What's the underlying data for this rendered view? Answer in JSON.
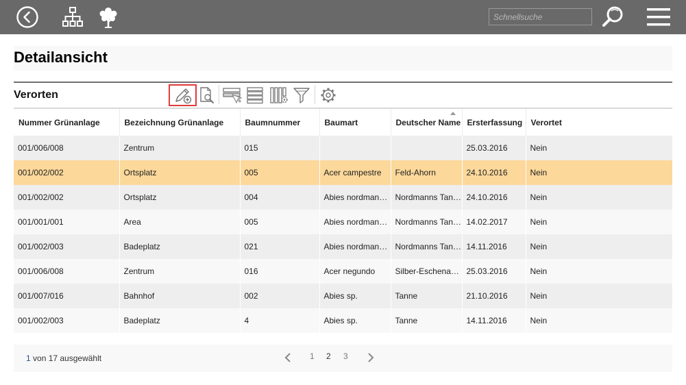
{
  "topbar": {
    "back_icon": "back-circle-icon",
    "tree_structure_icon": "hierarchy-icon",
    "tree_icon": "tree-icon",
    "search_placeholder": "Schnellsuche",
    "search_icon": "search-icon",
    "menu_icon": "hamburger-menu-icon",
    "bg_color": "#696969"
  },
  "page": {
    "title": "Detailansicht"
  },
  "section": {
    "title": "Verorten",
    "toolbar": [
      {
        "icon": "edit-add-icon",
        "active": true
      },
      {
        "icon": "document-search-icon"
      },
      {
        "icon": "row-select-icon"
      },
      {
        "icon": "list-rows-icon"
      },
      {
        "icon": "columns-settings-icon"
      },
      {
        "icon": "filter-icon"
      },
      {
        "icon": "gear-icon"
      }
    ]
  },
  "table": {
    "columns": [
      "Nummer Grünanlage",
      "Bezeichnung Grünanlage",
      "Baumnummer",
      "Baumart",
      "Deutscher Name",
      "Ersterfassung",
      "Verortet"
    ],
    "rows": [
      [
        "001/006/008",
        "Zentrum",
        "015",
        "",
        "",
        "25.03.2016",
        "Nein"
      ],
      [
        "001/002/002",
        "Ortsplatz",
        "005",
        "Acer campestre",
        "Feld-Ahorn",
        "24.10.2016",
        "Nein"
      ],
      [
        "001/002/002",
        "Ortsplatz",
        "004",
        "Abies nordmanniana",
        "Nordmanns Tanne",
        "24.10.2016",
        "Nein"
      ],
      [
        "001/001/001",
        "Area",
        "005",
        "Abies nordmanniana",
        "Nordmanns Tanne",
        "14.02.2017",
        "Nein"
      ],
      [
        "001/002/003",
        "Badeplatz",
        "021",
        "Abies nordmanniana",
        "Nordmanns Tanne",
        "14.11.2016",
        "Nein"
      ],
      [
        "001/006/008",
        "Zentrum",
        "016",
        "Acer negundo",
        "Silber-Eschenahorn",
        "25.03.2016",
        "Nein"
      ],
      [
        "001/007/016",
        "Bahnhof",
        "002",
        "Abies sp.",
        "Tanne",
        "21.10.2016",
        "Nein"
      ],
      [
        "001/002/003",
        "Badeplatz",
        "4",
        "Abies sp.",
        "Tanne",
        "14.11.2016",
        "Nein"
      ]
    ],
    "selected_row": 1,
    "selected_color": "#fcd89a"
  },
  "footer": {
    "selected_count": "1",
    "selected_text": " von 17 ausgewählt",
    "pages": [
      "1",
      "2",
      "3"
    ],
    "current_page": "2"
  },
  "accent_color": "#e03a3a"
}
